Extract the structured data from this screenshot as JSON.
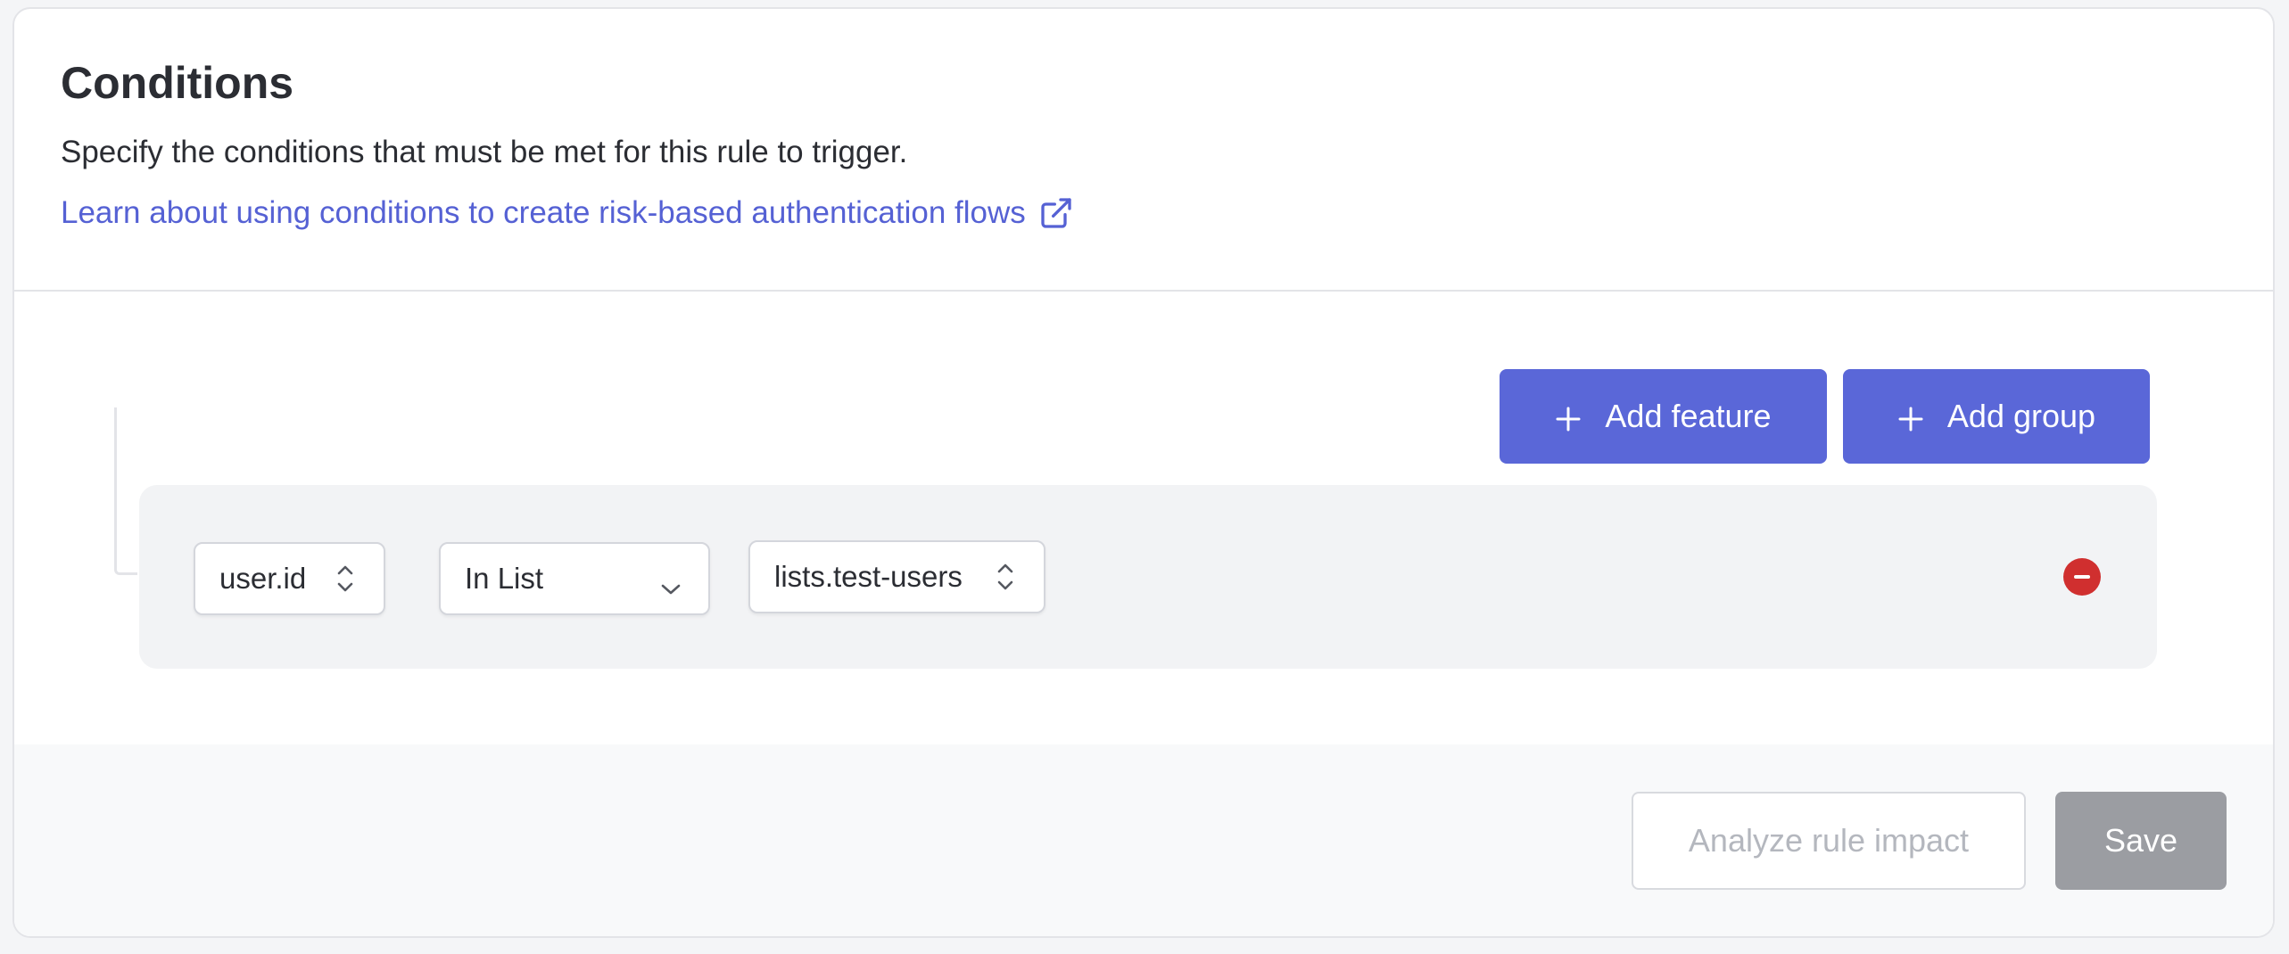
{
  "header": {
    "title": "Conditions",
    "description": "Specify the conditions that must be met for this rule to trigger.",
    "learn_link": "Learn about using conditions to create risk-based authentication flows",
    "learn_link_icon": "external-link-icon"
  },
  "toolbar": {
    "add_feature_label": "Add feature",
    "add_group_label": "Add group",
    "add_icon": "plus-icon"
  },
  "condition": {
    "feature": "user.id",
    "operator": "In List",
    "value": "lists.test-users",
    "remove_icon": "minus-circle-icon"
  },
  "footer": {
    "analyze_label": "Analyze rule impact",
    "save_label": "Save"
  },
  "colors": {
    "primary": "#5a67d8",
    "link": "#5561d4",
    "danger": "#d02f2f",
    "disabled": "#9b9da2"
  }
}
